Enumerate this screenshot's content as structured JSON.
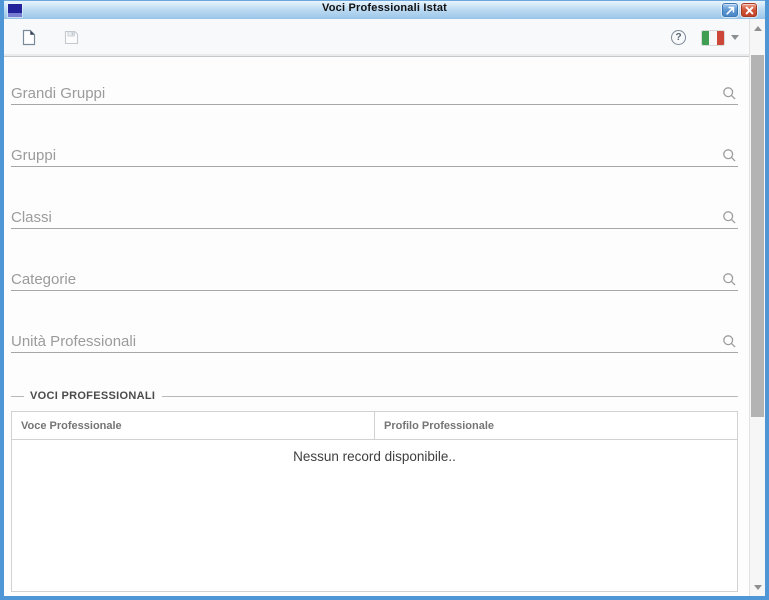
{
  "window": {
    "title": "Voci Professionali Istat",
    "controls": {
      "restore_icon": "restore-arrow",
      "close_icon": "close-x"
    }
  },
  "toolbar": {
    "help_glyph": "?",
    "icons": {
      "new_record": "new-document-icon",
      "save": "save-floppy-icon-disabled",
      "help": "help-question-icon",
      "language": "italy-flag-icon",
      "language_caret": "caret-down-icon"
    }
  },
  "filters": {
    "search_icon": "magnifier-icon",
    "fields": [
      {
        "placeholder": "Grandi Gruppi",
        "value": ""
      },
      {
        "placeholder": "Gruppi",
        "value": ""
      },
      {
        "placeholder": "Classi",
        "value": ""
      },
      {
        "placeholder": "Categorie",
        "value": ""
      },
      {
        "placeholder": "Unità Professionali",
        "value": ""
      }
    ]
  },
  "voci_section": {
    "legend": "VOCI PROFESSIONALI",
    "table": {
      "columns": [
        "Voce Professionale",
        "Profilo Professionale"
      ],
      "rows": [],
      "empty_message": "Nessun record disponibile.."
    }
  },
  "colors": {
    "frame_blue": "#4f96d6",
    "titlebar_blue": "#bedcf3",
    "close_red": "#c04228",
    "flag_green": "#3f9e52",
    "flag_red": "#cd4738",
    "placeholder_gray": "#9b9b9b"
  }
}
